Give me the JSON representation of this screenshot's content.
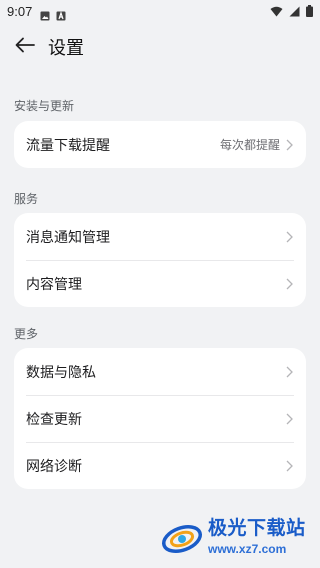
{
  "status_bar": {
    "time": "9:07"
  },
  "header": {
    "title": "设置"
  },
  "sections": [
    {
      "label": "安装与更新",
      "items": [
        {
          "label": "流量下载提醒",
          "value": "每次都提醒"
        }
      ]
    },
    {
      "label": "服务",
      "items": [
        {
          "label": "消息通知管理"
        },
        {
          "label": "内容管理"
        }
      ]
    },
    {
      "label": "更多",
      "items": [
        {
          "label": "数据与隐私"
        },
        {
          "label": "检查更新"
        },
        {
          "label": "网络诊断"
        }
      ]
    }
  ],
  "watermark": {
    "brand": "极光下载站",
    "url": "www.xz7.com"
  },
  "colors": {
    "background": "#f1f2f4",
    "card": "#ffffff",
    "secondary_text": "#6e6e73",
    "watermark_blue": "#1a5cc8"
  }
}
